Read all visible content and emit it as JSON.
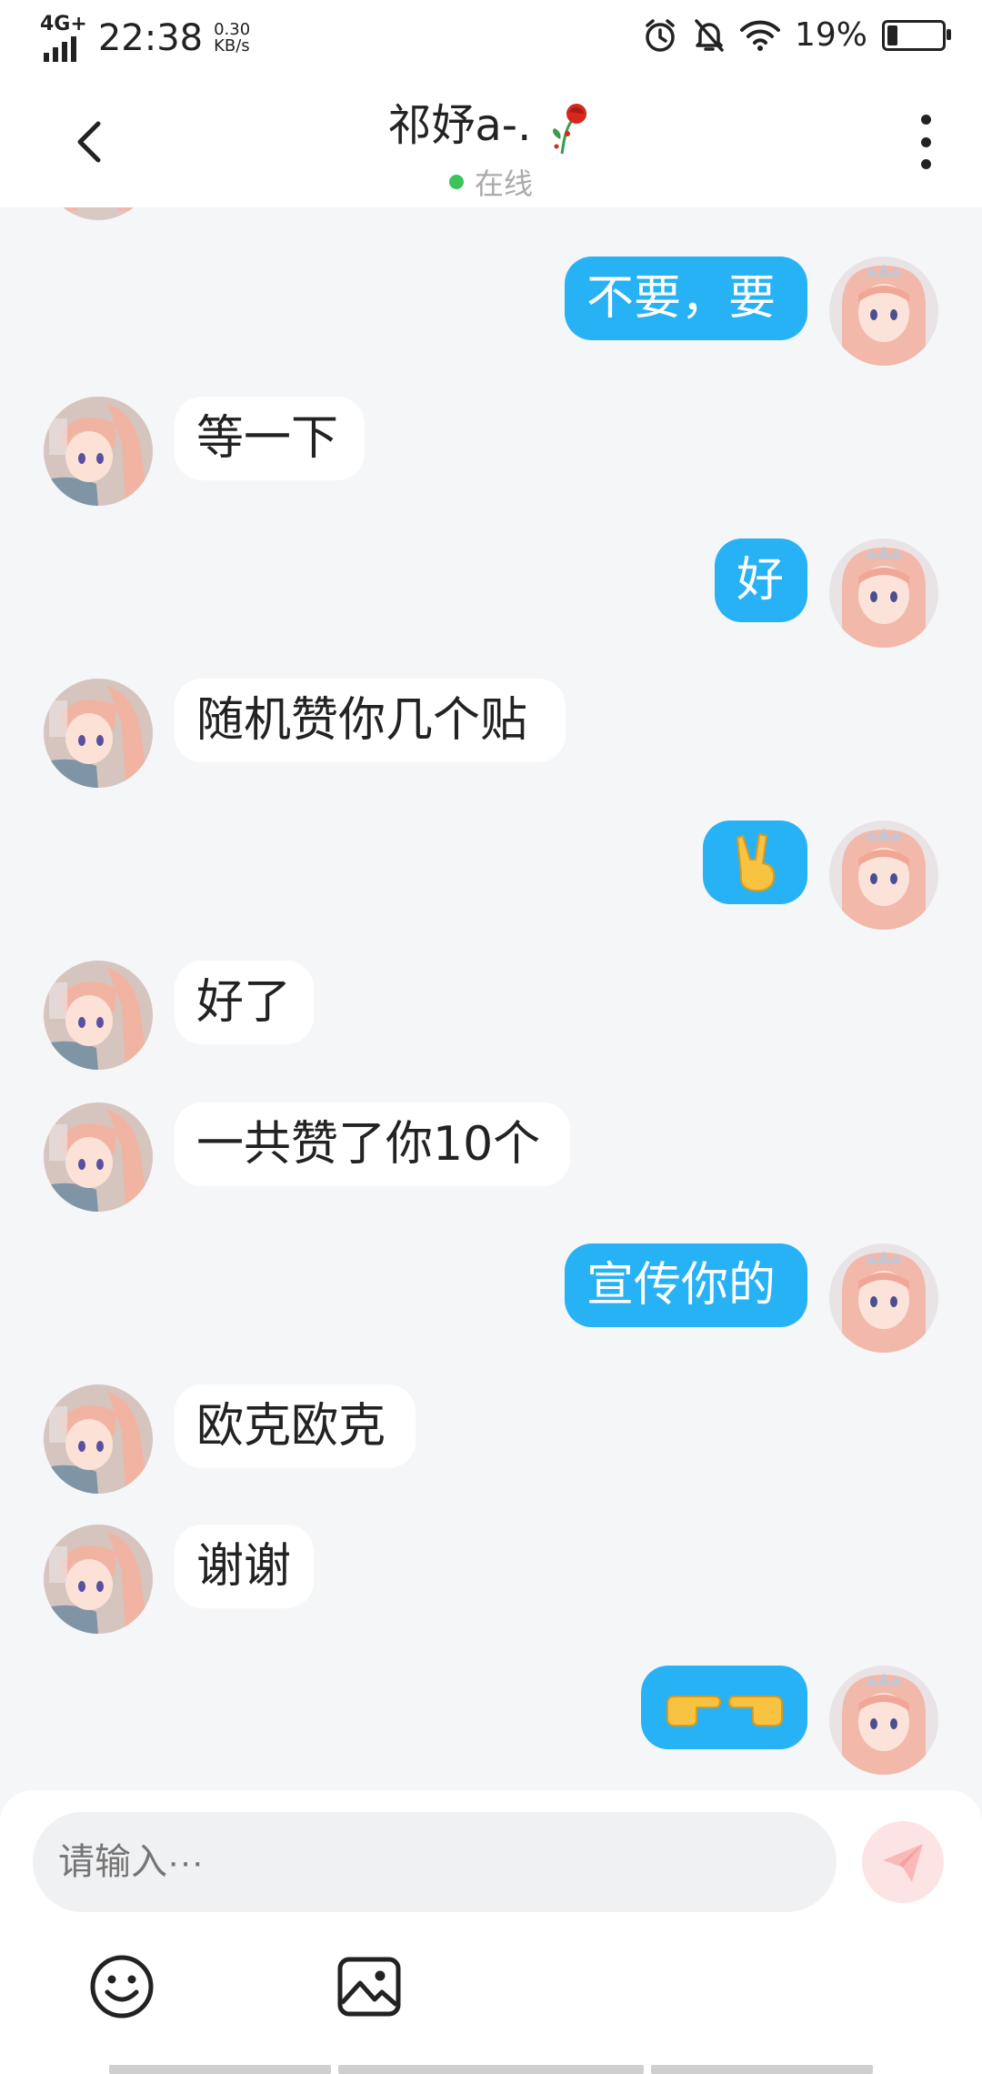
{
  "status_bar": {
    "network": "4G+",
    "time": "22:38",
    "speed_value": "0.30",
    "speed_unit": "KB/s",
    "battery_pct": "19%",
    "battery_level": 0.19
  },
  "header": {
    "title": "祁妤a-.",
    "status": "在线",
    "status_color": "#3cc45a"
  },
  "messages": [
    {
      "side": "out",
      "text": "不要，要"
    },
    {
      "side": "in",
      "text": "等一下"
    },
    {
      "side": "out",
      "text": "好"
    },
    {
      "side": "in",
      "text": "随机赞你几个贴"
    },
    {
      "side": "out",
      "text": "✌️"
    },
    {
      "side": "in",
      "text": "好了"
    },
    {
      "side": "in",
      "text": "一共赞了你10个"
    },
    {
      "side": "out",
      "text": "宣传你的"
    },
    {
      "side": "in",
      "text": "欧克欧克"
    },
    {
      "side": "in",
      "text": "谢谢"
    },
    {
      "side": "out",
      "text": "👉👈"
    }
  ],
  "input": {
    "placeholder": "请输入···"
  },
  "colors": {
    "outgoing_bubble": "#27b2f6",
    "incoming_bubble": "#ffffff",
    "background": "#f4f6f8"
  },
  "icons": [
    "back-icon",
    "more-icon",
    "rose-icon",
    "send-icon",
    "emoji-icon",
    "image-icon"
  ]
}
